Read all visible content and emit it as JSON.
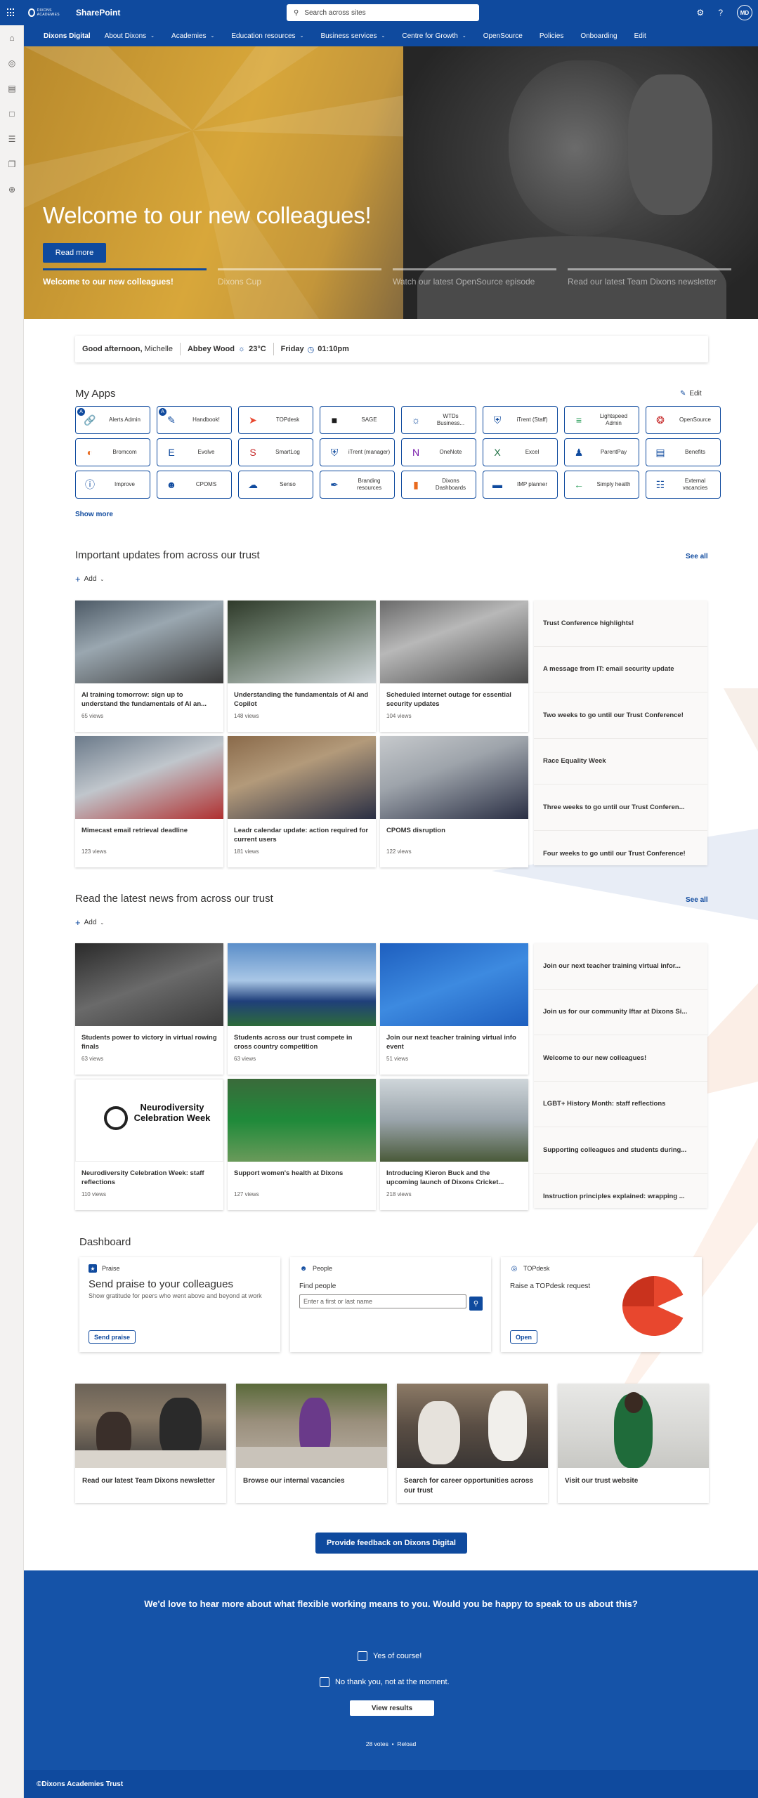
{
  "suite": {
    "logo_text": "DIXONS ACADEMIES",
    "title": "SharePoint",
    "search_placeholder": "Search across sites",
    "avatar_initials": "MD"
  },
  "hubnav": {
    "site": "Dixons Digital",
    "items": [
      "About Dixons",
      "Academies",
      "Education resources",
      "Business services",
      "Centre for Growth",
      "OpenSource",
      "Policies",
      "Onboarding",
      "Edit"
    ]
  },
  "hero": {
    "heading": "Welcome to our new colleagues!",
    "read_more": "Read more",
    "tabs": [
      "Welcome to our new colleagues!",
      "Dixons Cup",
      "Watch our latest OpenSource episode",
      "Read our latest Team Dixons newsletter"
    ]
  },
  "greeting": {
    "greeting_bold": "Good afternoon,",
    "name": "Michelle",
    "location": "Abbey Wood",
    "temp": "23°C",
    "day": "Friday",
    "time": "01:10pm"
  },
  "apps": {
    "title": "My Apps",
    "edit": "Edit",
    "show_more": "Show more",
    "items": [
      {
        "label": "Alerts Admin",
        "icon": "link-icon",
        "badge": "A"
      },
      {
        "label": "Handbook!",
        "icon": "document-shield-icon",
        "badge": "A"
      },
      {
        "label": "TOPdesk",
        "icon": "topdesk-icon"
      },
      {
        "label": "SAGE",
        "icon": "sage-icon"
      },
      {
        "label": "WTDs Business...",
        "icon": "sun-icon"
      },
      {
        "label": "iTrent (Staff)",
        "icon": "shield-icon"
      },
      {
        "label": "Lightspeed Admin",
        "icon": "lightspeed-icon"
      },
      {
        "label": "OpenSource",
        "icon": "opensource-icon"
      },
      {
        "label": "Bromcom",
        "icon": "bromcom-icon"
      },
      {
        "label": "Evolve",
        "icon": "evolve-icon"
      },
      {
        "label": "SmartLog",
        "icon": "smartlog-icon"
      },
      {
        "label": "iTrent (manager)",
        "icon": "shield-icon"
      },
      {
        "label": "OneNote",
        "icon": "onenote-icon"
      },
      {
        "label": "Excel",
        "icon": "excel-icon"
      },
      {
        "label": "ParentPay",
        "icon": "parentpay-icon"
      },
      {
        "label": "Benefits",
        "icon": "benefits-icon"
      },
      {
        "label": "Improve",
        "icon": "info-icon"
      },
      {
        "label": "CPOMS",
        "icon": "person-search-icon"
      },
      {
        "label": "Senso",
        "icon": "cloud-icon"
      },
      {
        "label": "Branding resources",
        "icon": "brush-icon"
      },
      {
        "label": "Dixons Dashboards",
        "icon": "bar-chart-icon"
      },
      {
        "label": "IMP planner",
        "icon": "imp-planner-icon"
      },
      {
        "label": "Simply health",
        "icon": "simply-health-icon"
      },
      {
        "label": "External vacancies",
        "icon": "vacancies-icon"
      }
    ]
  },
  "updates": {
    "title": "Important updates from across our trust",
    "see_all": "See all",
    "add": "Add",
    "cards": [
      {
        "title": "AI training tomorrow: sign up to understand the fundamentals of AI an...",
        "views": "65 views"
      },
      {
        "title": "Understanding the fundamentals of AI and Copilot",
        "views": "148 views"
      },
      {
        "title": "Scheduled internet outage for essential security updates",
        "views": "104 views"
      },
      {
        "title": "Mimecast email retrieval deadline",
        "views": "123 views"
      },
      {
        "title": "Leadr calendar update: action required for current users",
        "views": "181 views"
      },
      {
        "title": "CPOMS disruption",
        "views": "122 views"
      }
    ],
    "list": [
      "Trust Conference highlights!",
      "A message from IT: email security update",
      "Two weeks to go until our Trust Conference!",
      "Race Equality Week",
      "Three weeks to go until our Trust Conferen...",
      "Four weeks to go until our Trust Conference!"
    ]
  },
  "news": {
    "title": "Read the latest news from across our trust",
    "see_all": "See all",
    "add": "Add",
    "cards": [
      {
        "title": "Students power to victory in virtual rowing finals",
        "views": "63 views"
      },
      {
        "title": "Students across our trust compete in cross country competition",
        "views": "63 views"
      },
      {
        "title": "Join our next teacher training virtual info event",
        "views": "51 views"
      },
      {
        "title": "Neurodiversity Celebration Week: staff reflections",
        "views": "110 views"
      },
      {
        "title": "Support women's health at Dixons",
        "views": "127 views"
      },
      {
        "title": "Introducing Kieron Buck and the upcoming launch of Dixons Cricket...",
        "views": "218 views"
      }
    ],
    "neuro_image_text": "Neurodiversity Celebration Week",
    "list": [
      "Join our next teacher training virtual infor...",
      "Join us for our community Iftar at Dixons Si...",
      "Welcome to our new colleagues!",
      "LGBT+ History Month: staff reflections",
      "Supporting colleagues and students during...",
      "Instruction principles explained: wrapping ..."
    ]
  },
  "dashboard": {
    "title": "Dashboard",
    "praise": {
      "head": "Praise",
      "title": "Send praise to your colleagues",
      "desc": "Show gratitude for peers who went above and beyond at work",
      "button": "Send praise"
    },
    "people": {
      "head": "People",
      "sub": "Find people",
      "placeholder": "Enter a first or last name"
    },
    "topdesk": {
      "head": "TOPdesk",
      "sub": "Raise a TOPdesk request",
      "button": "Open"
    }
  },
  "links": [
    {
      "title": "Read our latest Team Dixons newsletter"
    },
    {
      "title": "Browse our internal vacancies"
    },
    {
      "title": "Search for career opportunities across our trust"
    },
    {
      "title": "Visit our trust website"
    }
  ],
  "feedback": "Provide feedback on Dixons Digital",
  "poll": {
    "question": "We'd love to hear more about what flexible working means to you. Would you be happy to speak to us about this?",
    "options": [
      "Yes of course!",
      "No thank you, not at the moment."
    ],
    "view_results": "View results",
    "votes": "28 votes",
    "reload": "Reload"
  },
  "footer": "©Dixons Academies Trust",
  "colors": {
    "brand": "#0f4a9e",
    "accent": "#1553a8"
  }
}
